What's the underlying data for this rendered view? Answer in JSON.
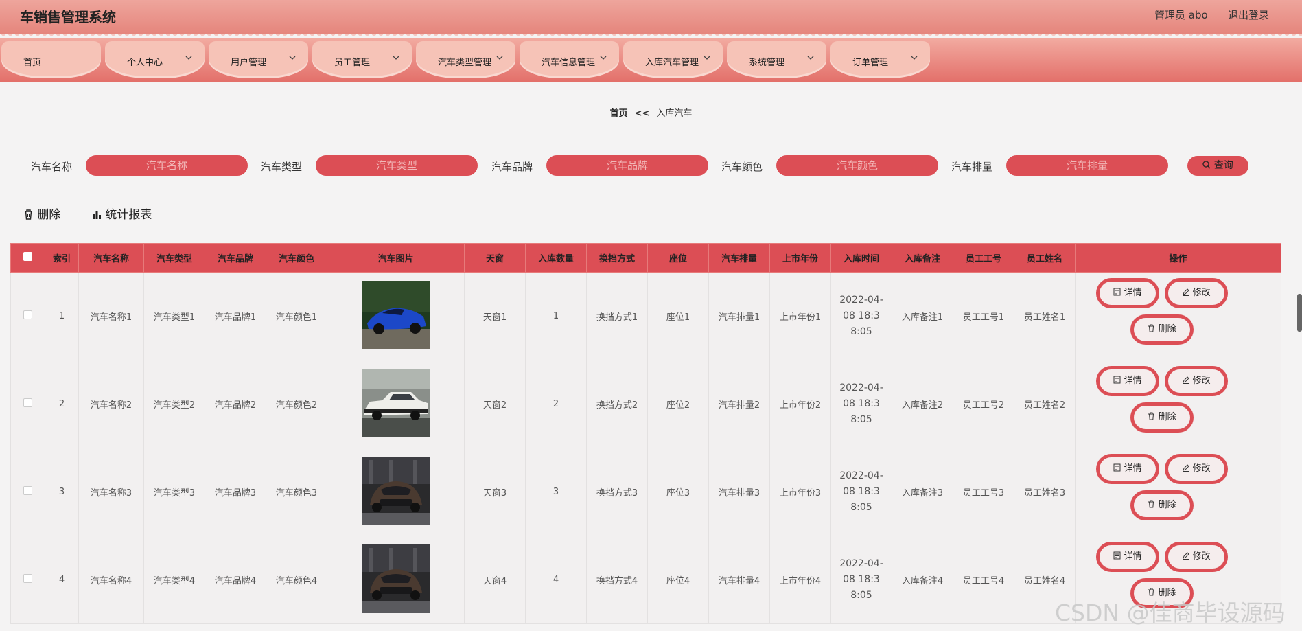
{
  "header": {
    "title": "车销售管理系统",
    "admin": "管理员 abo",
    "logout": "退出登录"
  },
  "nav": [
    {
      "label": "首页",
      "has_chevron": false
    },
    {
      "label": "个人中心",
      "has_chevron": true
    },
    {
      "label": "用户管理",
      "has_chevron": true
    },
    {
      "label": "员工管理",
      "has_chevron": true
    },
    {
      "label": "汽车类型管理",
      "has_chevron": true
    },
    {
      "label": "汽车信息管理",
      "has_chevron": true
    },
    {
      "label": "入库汽车管理",
      "has_chevron": true
    },
    {
      "label": "系统管理",
      "has_chevron": true
    },
    {
      "label": "订单管理",
      "has_chevron": true
    }
  ],
  "breadcrumb": {
    "home": "首页",
    "sep": "<<",
    "current": "入库汽车"
  },
  "search": {
    "fields": [
      {
        "label": "汽车名称",
        "placeholder": "汽车名称"
      },
      {
        "label": "汽车类型",
        "placeholder": "汽车类型"
      },
      {
        "label": "汽车品牌",
        "placeholder": "汽车品牌"
      },
      {
        "label": "汽车颜色",
        "placeholder": "汽车颜色"
      },
      {
        "label": "汽车排量",
        "placeholder": "汽车排量"
      }
    ],
    "button": "查询"
  },
  "actions": {
    "delete": "删除",
    "stats": "统计报表"
  },
  "table": {
    "headers": [
      "索引",
      "汽车名称",
      "汽车类型",
      "汽车品牌",
      "汽车颜色",
      "汽车图片",
      "天窗",
      "入库数量",
      "换挡方式",
      "座位",
      "汽车排量",
      "上市年份",
      "入库时间",
      "入库备注",
      "员工工号",
      "员工姓名",
      "操作"
    ],
    "rows": [
      {
        "index": "1",
        "name": "汽车名称1",
        "type": "汽车类型1",
        "brand": "汽车品牌1",
        "color": "汽车颜色1",
        "image": "blue-sports-car",
        "sunroof": "天窗1",
        "qty": "1",
        "gear": "换挡方式1",
        "seats": "座位1",
        "displacement": "汽车排量1",
        "year": "上市年份1",
        "time": "2022-04-08 18:38:05",
        "note": "入库备注1",
        "emp_no": "员工工号1",
        "emp_name": "员工姓名1"
      },
      {
        "index": "2",
        "name": "汽车名称2",
        "type": "汽车类型2",
        "brand": "汽车品牌2",
        "color": "汽车颜色2",
        "image": "white-classic-car",
        "sunroof": "天窗2",
        "qty": "2",
        "gear": "换挡方式2",
        "seats": "座位2",
        "displacement": "汽车排量2",
        "year": "上市年份2",
        "time": "2022-04-08 18:38:05",
        "note": "入库备注2",
        "emp_no": "员工工号2",
        "emp_name": "员工姓名2"
      },
      {
        "index": "3",
        "name": "汽车名称3",
        "type": "汽车类型3",
        "brand": "汽车品牌3",
        "color": "汽车颜色3",
        "image": "dark-sedan-showroom",
        "sunroof": "天窗3",
        "qty": "3",
        "gear": "换挡方式3",
        "seats": "座位3",
        "displacement": "汽车排量3",
        "year": "上市年份3",
        "time": "2022-04-08 18:38:05",
        "note": "入库备注3",
        "emp_no": "员工工号3",
        "emp_name": "员工姓名3"
      },
      {
        "index": "4",
        "name": "汽车名称4",
        "type": "汽车类型4",
        "brand": "汽车品牌4",
        "color": "汽车颜色4",
        "image": "dark-sedan-showroom",
        "sunroof": "天窗4",
        "qty": "4",
        "gear": "换挡方式4",
        "seats": "座位4",
        "displacement": "汽车排量4",
        "year": "上市年份4",
        "time": "2022-04-08 18:38:05",
        "note": "入库备注4",
        "emp_no": "员工工号4",
        "emp_name": "员工姓名4"
      }
    ],
    "row_buttons": {
      "detail": "详情",
      "edit": "修改",
      "delete": "删除"
    }
  },
  "watermark": "CSDN @佳商毕设源码",
  "colors": {
    "accent": "#dc4e55",
    "nav_top": "#f2aaa0",
    "nav_bottom": "#e3706a",
    "tab": "#f6c3b7"
  }
}
